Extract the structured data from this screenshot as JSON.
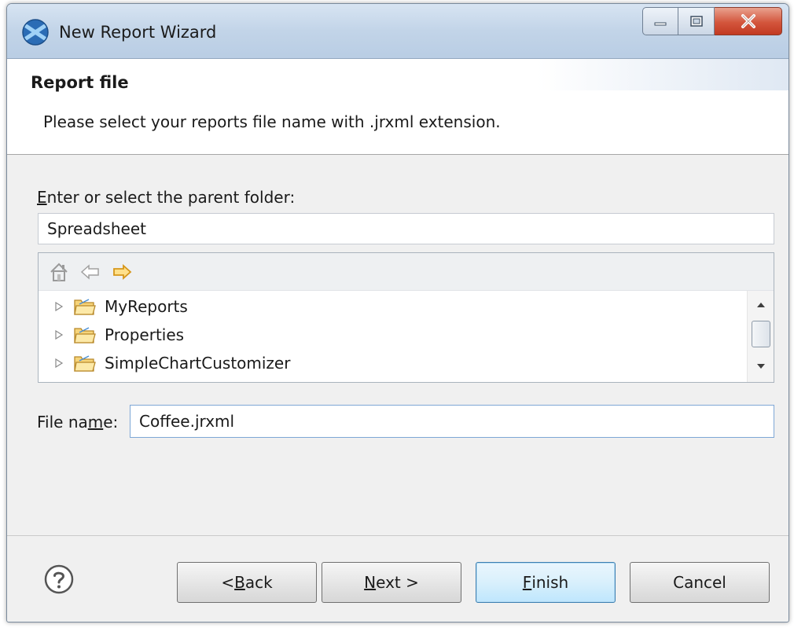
{
  "window": {
    "title": "New Report Wizard",
    "icon": "jaspersoft-app-icon",
    "controls": [
      "minimize-icon",
      "maximize-icon",
      "close-icon"
    ]
  },
  "header": {
    "title": "Report file",
    "description": "Please select your reports file name with .jrxml extension."
  },
  "folder_selector": {
    "label_mnemonic": "E",
    "label_rest": "nter or select the parent folder:",
    "value": "Spreadsheet"
  },
  "tree": {
    "toolbar": [
      "home-icon",
      "back-arrow-icon",
      "forward-arrow-icon"
    ],
    "items": [
      {
        "label": "MyReports",
        "icon": "folder-icon"
      },
      {
        "label": "Properties",
        "icon": "folder-icon"
      },
      {
        "label": "SimpleChartCustomizer",
        "icon": "folder-icon"
      }
    ]
  },
  "file_name": {
    "label_pre": "File na",
    "label_mnemonic": "m",
    "label_post": "e:",
    "value": "Coffee.jrxml"
  },
  "buttons": {
    "back": {
      "pre": "< ",
      "mnemonic": "B",
      "post": "ack"
    },
    "next": {
      "pre": "",
      "mnemonic": "N",
      "post": "ext >"
    },
    "finish": {
      "pre": "",
      "mnemonic": "F",
      "post": "inish"
    },
    "cancel": {
      "label": "Cancel"
    }
  },
  "colors": {
    "titlebar": "#c2d4e8",
    "close_button": "#d3553c",
    "default_button_border": "#3c7fb1",
    "folder_yellow": "#f2c25a",
    "forward_arrow": "#f0b428"
  }
}
